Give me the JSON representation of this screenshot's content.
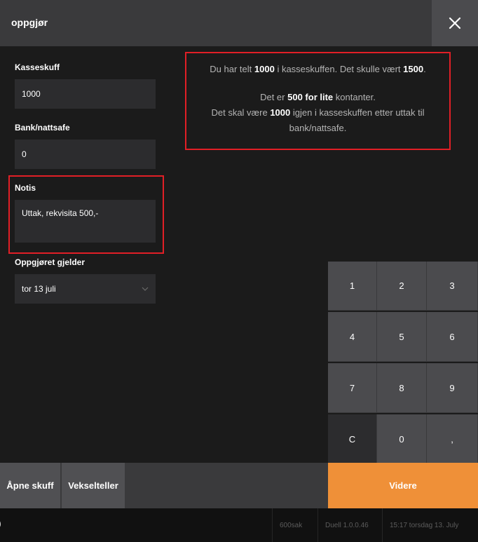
{
  "header": {
    "title": "oppgjør"
  },
  "fields": {
    "kasseskuff": {
      "label": "Kasseskuff",
      "value": "1000"
    },
    "bank": {
      "label": "Bank/nattsafe",
      "value": "0"
    },
    "notis": {
      "label": "Notis",
      "value": "Uttak, rekvisita 500,-"
    },
    "date": {
      "label": "Oppgjøret gjelder",
      "value": "tor 13 juli"
    }
  },
  "info": {
    "l1_a": "Du har telt",
    "l1_b": "1000",
    "l1_c": "i kasseskuffen. Det skulle vært",
    "l1_d": "1500",
    "l1_e": ".",
    "l2_a": "Det er",
    "l2_b": "500 for lite",
    "l2_c": "kontanter.",
    "l3_a": "Det skal være",
    "l3_b": "1000",
    "l3_c": "igjen i kasseskuffen etter uttak til",
    "l4": "bank/nattsafe."
  },
  "keypad": {
    "keys": [
      "1",
      "2",
      "3",
      "4",
      "5",
      "6",
      "7",
      "8",
      "9",
      "C",
      "0",
      ","
    ]
  },
  "buttons": {
    "open_drawer": "Åpne skuff",
    "change_counter": "Vekselteller",
    "next": "Videre"
  },
  "status": {
    "left": ")",
    "cell1": "600sak",
    "cell2": "Duell 1.0.0.46",
    "cell3": "15:17 torsdag 13. July"
  },
  "colors": {
    "accent": "#ef9038",
    "highlight": "#e11f26"
  }
}
